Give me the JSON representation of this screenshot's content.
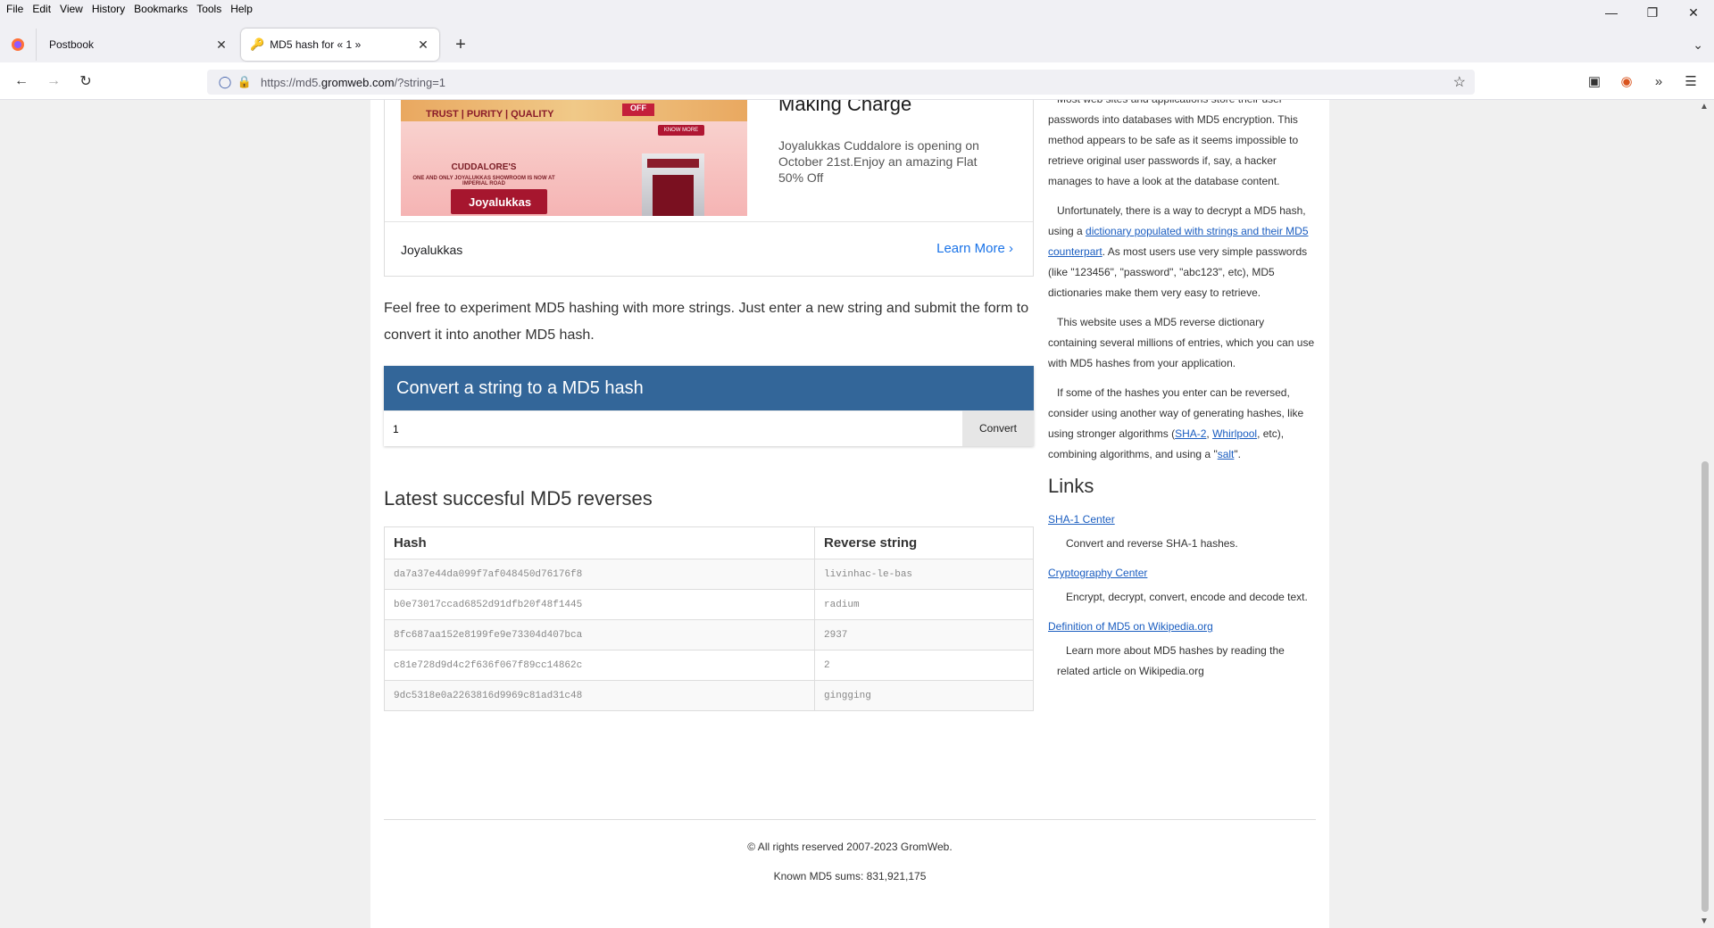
{
  "menu": [
    "File",
    "Edit",
    "View",
    "History",
    "Bookmarks",
    "Tools",
    "Help"
  ],
  "tabs": [
    {
      "label": "Postbook",
      "active": false
    },
    {
      "label": "MD5 hash for « 1 »",
      "active": true
    }
  ],
  "url": {
    "prefix": "https://md5.",
    "domain": "gromweb.com",
    "path": "/?string=1"
  },
  "ad": {
    "img_trust": "TRUST | PURITY | QUALITY",
    "img_off": "OFF",
    "img_know": "KNOW MORE",
    "img_cuddalore": "CUDDALORE'S",
    "img_showroom": "ONE AND ONLY JOYALUKKAS SHOWROOM IS NOW AT IMPERIAL ROAD",
    "img_logo": "Joyalukkas",
    "headline": "Making Charge",
    "description": "Joyalukkas Cuddalore is opening on October 21st.Enjoy an amazing Flat 50% Off",
    "brand": "Joyalukkas",
    "cta": "Learn More"
  },
  "intro": "Feel free to experiment MD5 hashing with more strings. Just enter a new string and submit the form to convert it into another MD5 hash.",
  "convert": {
    "title": "Convert a string to a MD5 hash",
    "value": "1",
    "button": "Convert"
  },
  "latest": {
    "title": "Latest succesful MD5 reverses",
    "columns": [
      "Hash",
      "Reverse string"
    ],
    "rows": [
      {
        "hash": "da7a37e44da099f7af048450d76176f8",
        "reverse": "livinhac-le-bas"
      },
      {
        "hash": "b0e73017ccad6852d91dfb20f48f1445",
        "reverse": "radium"
      },
      {
        "hash": "8fc687aa152e8199fe9e73304d407bca",
        "reverse": "2937"
      },
      {
        "hash": "c81e728d9d4c2f636f067f89cc14862c",
        "reverse": "2"
      },
      {
        "hash": "9dc5318e0a2263816d9969c81ad31c48",
        "reverse": "gingging"
      }
    ]
  },
  "sidebar": {
    "p1": "Most web sites and applications store their user passwords into databases with MD5 encryption. This method appears to be safe as it seems impossible to retrieve original user passwords if, say, a hacker manages to have a look at the database content.",
    "p2_pre": "Unfortunately, there is a way to decrypt a MD5 hash, using a ",
    "p2_link": "dictionary populated with strings and their MD5 counterpart",
    "p2_post": ". As most users use very simple passwords (like \"123456\", \"password\", \"abc123\", etc), MD5 dictionaries make them very easy to retrieve.",
    "p3": "This website uses a MD5 reverse dictionary containing several millions of entries, which you can use with MD5 hashes from your application.",
    "p4_pre": "If some of the hashes you enter can be reversed, consider using another way of generating hashes, like using stronger algorithms (",
    "p4_link1": "SHA-2",
    "p4_sep": ", ",
    "p4_link2": "Whirlpool",
    "p4_mid": ", etc), combining algorithms, and using a \"",
    "p4_link3": "salt",
    "p4_post": "\".",
    "links_title": "Links",
    "links": [
      {
        "title": "SHA-1 Center",
        "desc": "Convert and reverse SHA-1 hashes."
      },
      {
        "title": "Cryptography Center",
        "desc": "Encrypt, decrypt, convert, encode and decode text."
      },
      {
        "title": "Definition of MD5 on Wikipedia.org",
        "desc": "Learn more about MD5 hashes by reading the related article on Wikipedia.org"
      }
    ]
  },
  "footer": {
    "copyright": "© All rights reserved 2007-2023 GromWeb.",
    "known": "Known MD5 sums: 831,921,175"
  }
}
